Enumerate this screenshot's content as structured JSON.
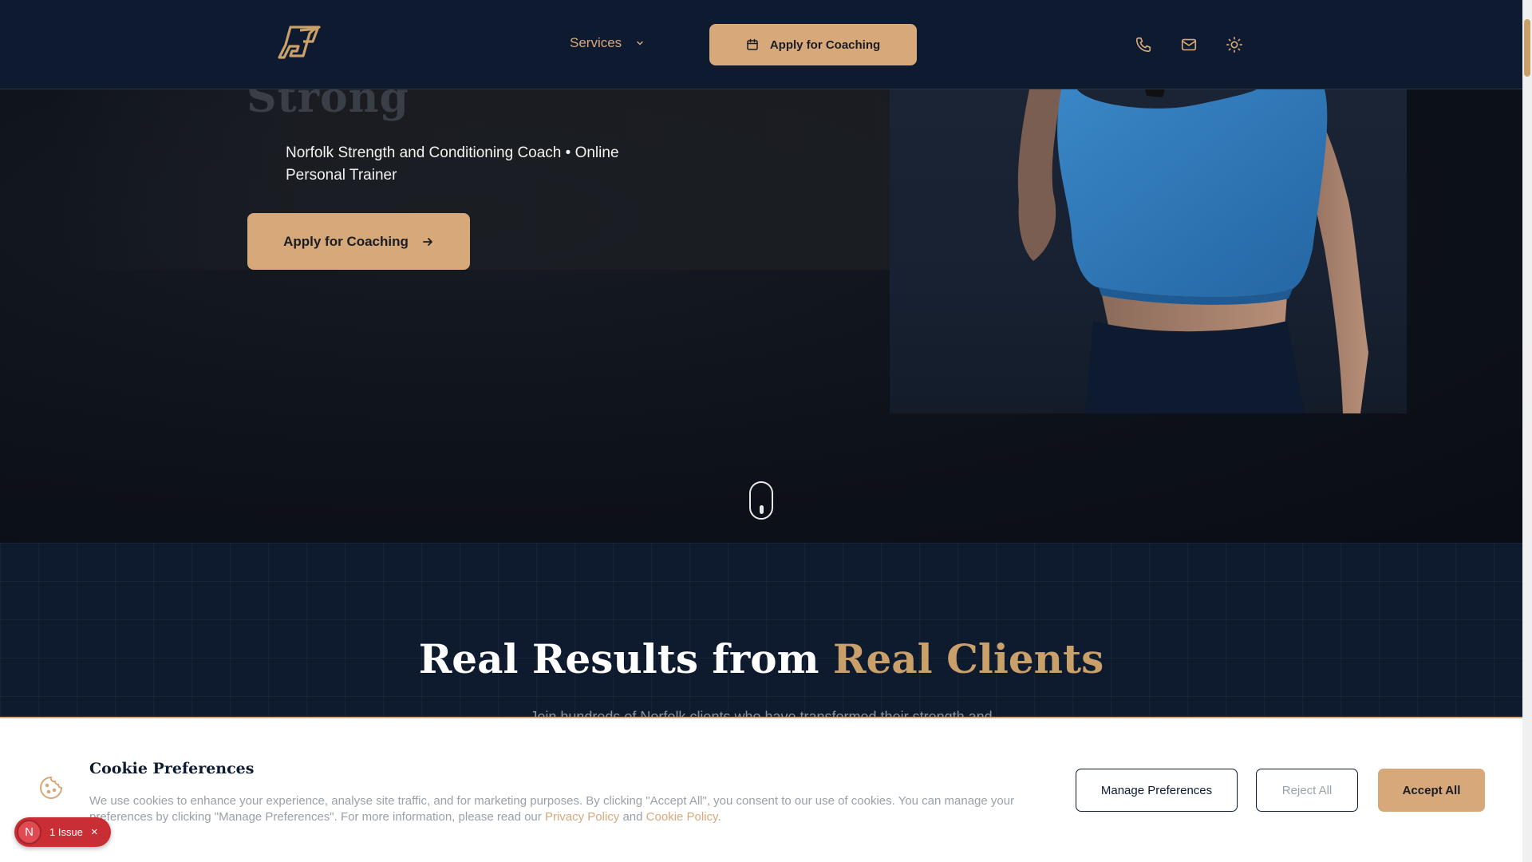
{
  "header": {
    "logo_alt": "LFP",
    "nav_services": "Services",
    "cta": "Apply for Coaching",
    "icons": [
      "phone-icon",
      "mail-icon",
      "sun-icon"
    ]
  },
  "hero": {
    "title_fragment": "Strong",
    "subtitle": "Norfolk Strength and Conditioning Coach • Online Personal Trainer",
    "cta": "Apply for Coaching"
  },
  "results": {
    "title_main": "Real Results from ",
    "title_accent": "Real Clients",
    "subtitle_fragment": "Join hundreds of Norfolk clients who have transformed their strength and"
  },
  "cookie": {
    "title": "Cookie Preferences",
    "text_before": "We use cookies to enhance your experience, analyse site traffic, and for marketing purposes. By clicking \"Accept All\", you consent to our use of cookies. You can manage your preferences by clicking \"Manage Preferences\". For more information, please read our ",
    "privacy_link": "Privacy Policy",
    "and": " and ",
    "cookie_link": "Cookie Policy",
    "period": ".",
    "manage": "Manage Preferences",
    "reject": "Reject All",
    "accept": "Accept All"
  },
  "issue_badge": {
    "letter": "N",
    "label": "1 Issue",
    "close": "×"
  },
  "colors": {
    "navy": "#0d1a30",
    "accent": "#d7a87a",
    "issue_red": "#c92e34"
  }
}
